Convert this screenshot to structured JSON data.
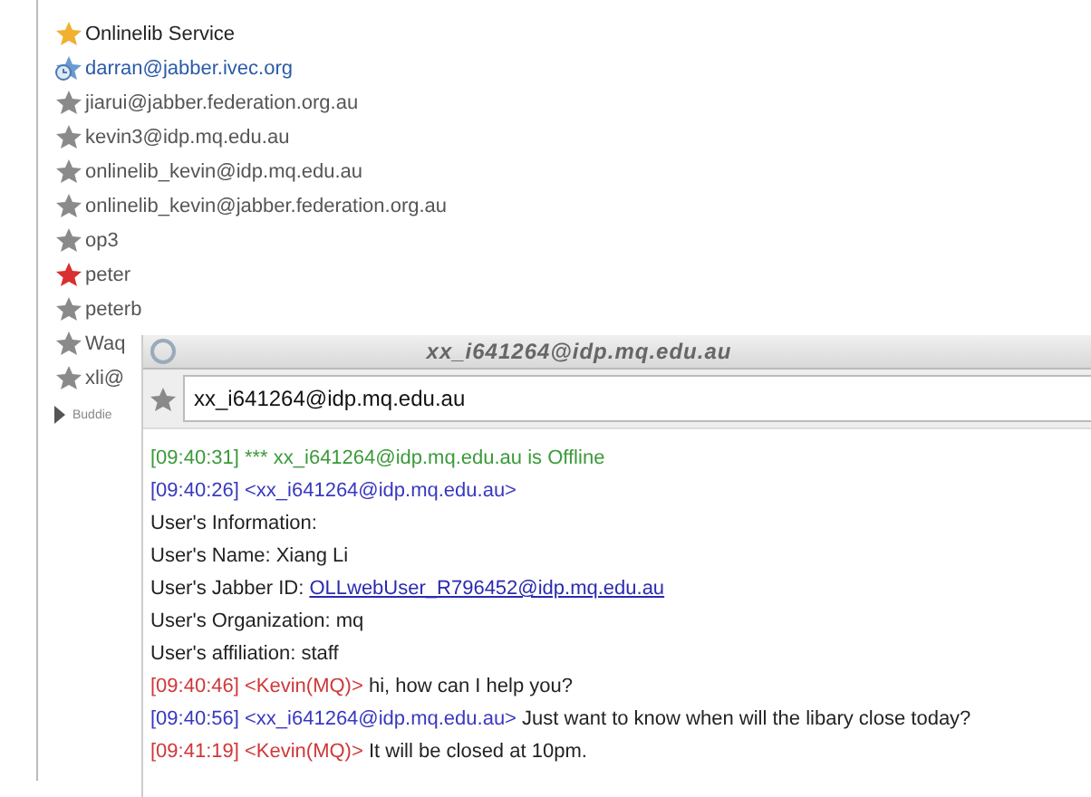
{
  "buddies": [
    {
      "name": "Onlinelib Service",
      "kind": "star",
      "color": "#f0b030"
    },
    {
      "name": "darran@jabber.ivec.org",
      "kind": "clock",
      "color": "#6a9ad0"
    },
    {
      "name": "jiarui@jabber.federation.org.au",
      "kind": "star",
      "color": "#8a8a8a"
    },
    {
      "name": "kevin3@idp.mq.edu.au",
      "kind": "star",
      "color": "#8a8a8a"
    },
    {
      "name": "onlinelib_kevin@idp.mq.edu.au",
      "kind": "star",
      "color": "#8a8a8a"
    },
    {
      "name": "onlinelib_kevin@jabber.federation.org.au",
      "kind": "star",
      "color": "#8a8a8a"
    },
    {
      "name": "op3",
      "kind": "star",
      "color": "#8a8a8a"
    },
    {
      "name": "peter",
      "kind": "star",
      "color": "#d83030"
    },
    {
      "name": "peterb",
      "kind": "star",
      "color": "#8a8a8a"
    },
    {
      "name": "Waq",
      "kind": "star",
      "color": "#8a8a8a"
    },
    {
      "name": "xli@",
      "kind": "star",
      "color": "#8a8a8a"
    }
  ],
  "group": {
    "label": "Buddie",
    "expanded": false
  },
  "chat": {
    "title": "xx_i641264@idp.mq.edu.au",
    "contact": "xx_i641264@idp.mq.edu.au",
    "messages": [
      {
        "kind": "status",
        "text": "[09:40:31] *** xx_i641264@idp.mq.edu.au is Offline"
      },
      {
        "kind": "them",
        "time": "[09:40:26]",
        "sender": "<xx_i641264@idp.mq.edu.au>"
      },
      {
        "kind": "info",
        "text": "User's Information:"
      },
      {
        "kind": "info",
        "text": "User's Name: Xiang Li"
      },
      {
        "kind": "info",
        "text": "User's Jabber ID:",
        "link": "OLLwebUser_R796452@idp.mq.edu.au"
      },
      {
        "kind": "info",
        "text": "User's Organization: mq"
      },
      {
        "kind": "info",
        "text": "User's affiliation: staff"
      },
      {
        "kind": "me",
        "time": "[09:40:46]",
        "sender": "<Kevin(MQ)>",
        "text": "hi, how can I help you?"
      },
      {
        "kind": "them",
        "time": "[09:40:56]",
        "sender": "<xx_i641264@idp.mq.edu.au>",
        "text": "Just want to know when will the libary close today?"
      },
      {
        "kind": "me",
        "time": "[09:41:19]",
        "sender": "<Kevin(MQ)>",
        "text": "It will be closed at 10pm."
      }
    ]
  }
}
